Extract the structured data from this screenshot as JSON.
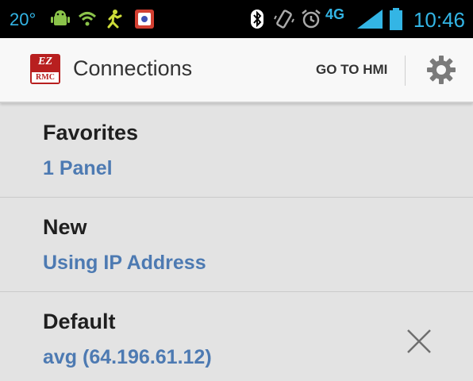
{
  "status_bar": {
    "temperature": "20°",
    "time": "10:46",
    "network": "4G",
    "icons": [
      "android-icon",
      "wifi-icon",
      "activity-icon",
      "app-icon",
      "bluetooth-icon",
      "vibrate-icon",
      "alarm-icon",
      "network-4g-icon",
      "signal-icon",
      "battery-icon"
    ]
  },
  "action_bar": {
    "logo_text_top": "EZ",
    "logo_text_bottom": "RMC",
    "title": "Connections",
    "goto_label": "GO TO HMI",
    "settings_icon": "gear-icon"
  },
  "connections": [
    {
      "title": "Favorites",
      "subtitle": "1 Panel"
    },
    {
      "title": "New",
      "subtitle": "Using IP Address"
    },
    {
      "title": "Default",
      "subtitle": "avg (64.196.61.12)",
      "action_icon": "close-icon"
    }
  ],
  "colors": {
    "accent_blue": "#4d7ab2",
    "status_blue": "#33b5e5",
    "background": "#e3e3e3"
  }
}
